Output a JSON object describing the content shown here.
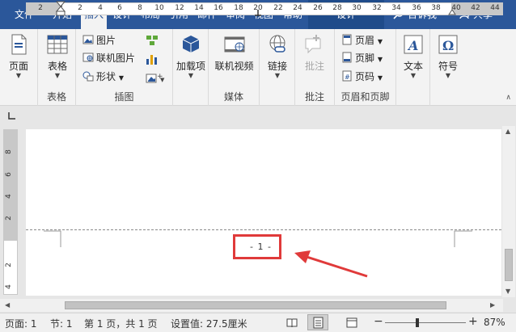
{
  "tabs": [
    {
      "label": "文件"
    },
    {
      "label": "开始"
    },
    {
      "label": "插入"
    },
    {
      "label": "设计"
    },
    {
      "label": "布局"
    },
    {
      "label": "引用"
    },
    {
      "label": "邮件"
    },
    {
      "label": "审阅"
    },
    {
      "label": "视图"
    },
    {
      "label": "帮助"
    }
  ],
  "context_tab": "设计",
  "tell_me": "告诉我",
  "share": "共享",
  "ribbon": {
    "pages": {
      "button": "页面",
      "group": ""
    },
    "tables": {
      "button": "表格",
      "group": "表格"
    },
    "illustrations": {
      "picture": "图片",
      "online_picture": "联机图片",
      "shapes": "形状",
      "group": "插图"
    },
    "addins": {
      "button": "加载项"
    },
    "media": {
      "button": "联机视频",
      "group": "媒体"
    },
    "links": {
      "button": "链接"
    },
    "comments": {
      "button": "批注",
      "group": "批注"
    },
    "header_footer": {
      "header": "页眉",
      "footer": "页脚",
      "page_number": "页码",
      "group": "页眉和页脚"
    },
    "text": {
      "button": "文本"
    },
    "symbols": {
      "button": "符号"
    }
  },
  "ruler_numbers": [
    "2",
    "2",
    "2",
    "4",
    "6",
    "8",
    "10",
    "12",
    "14",
    "16",
    "18",
    "20",
    "22",
    "24",
    "26",
    "28",
    "30",
    "32",
    "34",
    "36",
    "38",
    "40",
    "42",
    "44"
  ],
  "vruler_numbers": [
    "8",
    "6",
    "4",
    "2",
    "2",
    "4"
  ],
  "document": {
    "page_number_text": "- 1 -"
  },
  "status": {
    "page": "页面: 1",
    "section": "节: 1",
    "page_of": "第 1 页，共 1 页",
    "position": "设置值: 27.5厘米",
    "zoom": "87%"
  }
}
